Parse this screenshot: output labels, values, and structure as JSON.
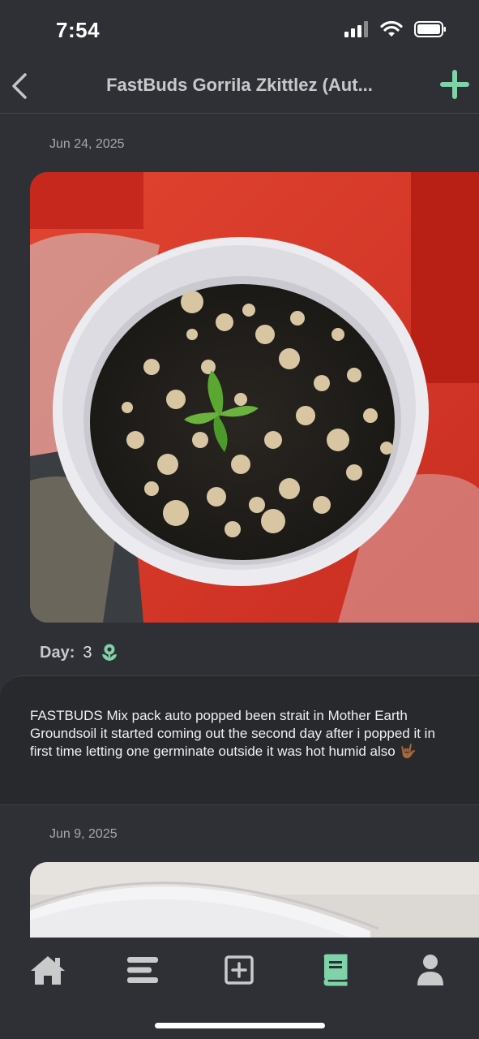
{
  "status_bar": {
    "time": "7:54"
  },
  "header": {
    "title": "FastBuds Gorrila Zkittlez (Aut..."
  },
  "entries": [
    {
      "date": "Jun 24, 2025",
      "day_label": "Day:",
      "day_value": "3",
      "note": "FASTBUDS Mix pack auto popped been strait in Mother Earth Groundsoil it started coming out the second day after i popped it in first time letting one germinate outside it was hot humid also 🤟🏾"
    },
    {
      "date": "Jun 9, 2025"
    }
  ],
  "tabs": [
    "home-icon",
    "list-icon",
    "add-entry-icon",
    "journal-icon",
    "profile-icon"
  ],
  "colors": {
    "accent": "#7fd3a8",
    "background": "#2e3035",
    "card": "#27292d",
    "inactive_icon": "#c9cacc"
  }
}
